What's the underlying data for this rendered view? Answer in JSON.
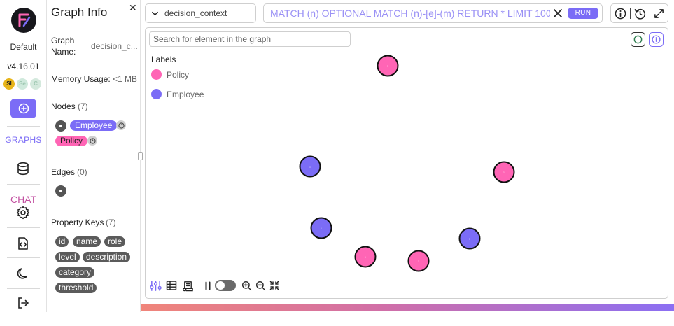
{
  "rail": {
    "workspace": "Default",
    "version": "v4.16.01",
    "badges": [
      {
        "text": "SI",
        "bg": "#e8b51a",
        "color": "#222222"
      },
      {
        "text": "Se",
        "bg": "#cfe9dc",
        "color": "#9fc8b2"
      },
      {
        "text": "C",
        "bg": "#d4e9dd",
        "color": "#9fc8b2"
      }
    ],
    "graphs_label": "GRAPHS",
    "chat_label": "CHAT"
  },
  "panel": {
    "title": "Graph Info",
    "graph_name_label": "Graph Name:",
    "graph_name_value": "decision_c...",
    "memory_label": "Memory Usage:",
    "memory_value": "<1 MB",
    "nodes_label": "Nodes",
    "nodes_count": "(7)",
    "node_labels": [
      "Employee",
      "Policy"
    ],
    "edges_label": "Edges",
    "edges_count": "(0)",
    "property_keys_label": "Property Keys",
    "property_keys_count": "(7)",
    "property_keys": [
      "id",
      "name",
      "role",
      "level",
      "description",
      "category",
      "threshold"
    ]
  },
  "topbar": {
    "graph_selected": "decision_context",
    "query": "MATCH (n) OPTIONAL MATCH (n)-[e]-(m) RETURN * LIMIT 100",
    "run_label": "RUN"
  },
  "canvas": {
    "search_placeholder": "Search for element in the graph",
    "labels_title": "Labels",
    "legend": [
      {
        "name": "Policy",
        "color": "#ff65b5"
      },
      {
        "name": "Employee",
        "color": "#7b6cf6"
      }
    ],
    "node_caption": "1"
  },
  "colors": {
    "accent": "#7b6cf6",
    "policy": "#ff65b5",
    "employee": "#7b6cf6",
    "chat": "#c24fa0"
  }
}
